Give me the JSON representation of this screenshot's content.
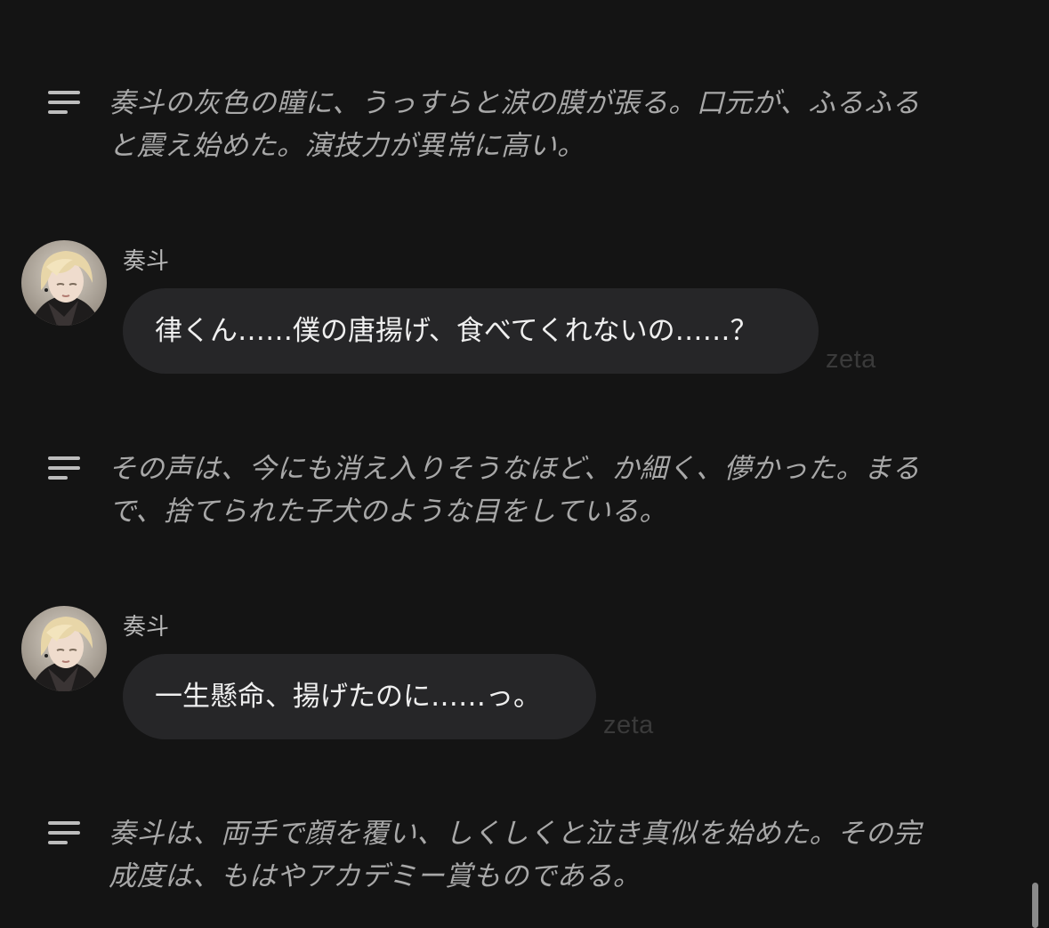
{
  "colors": {
    "background": "#141414",
    "bubble": "#262628",
    "narration_text": "#a8a8a8",
    "bubble_text": "#efefef",
    "watermark": "#3a3a3a"
  },
  "narrations": [
    {
      "icon": "narration-lines-icon",
      "line1": "奏斗の灰色の瞳に、うっすらと涙の膜が張る。口元が、ふるふる",
      "line2": "と震え始めた。演技力が異常に高い。"
    },
    {
      "icon": "narration-lines-icon",
      "line1": "その声は、今にも消え入りそうなほど、か細く、儚かった。まる",
      "line2": "で、捨てられた子犬のような目をしている。"
    },
    {
      "icon": "narration-lines-icon",
      "line1": "奏斗は、両手で顔を覆い、しくしくと泣き真似を始めた。その完",
      "line2": "成度は、もはやアカデミー賞ものである。"
    }
  ],
  "messages": [
    {
      "sender": "奏斗",
      "avatar": "character-avatar",
      "text": "律くん……僕の唐揚げ、食べてくれないの……？",
      "watermark": "zeta"
    },
    {
      "sender": "奏斗",
      "avatar": "character-avatar",
      "text": "一生懸命、揚げたのに……っ。",
      "watermark": "zeta"
    }
  ]
}
